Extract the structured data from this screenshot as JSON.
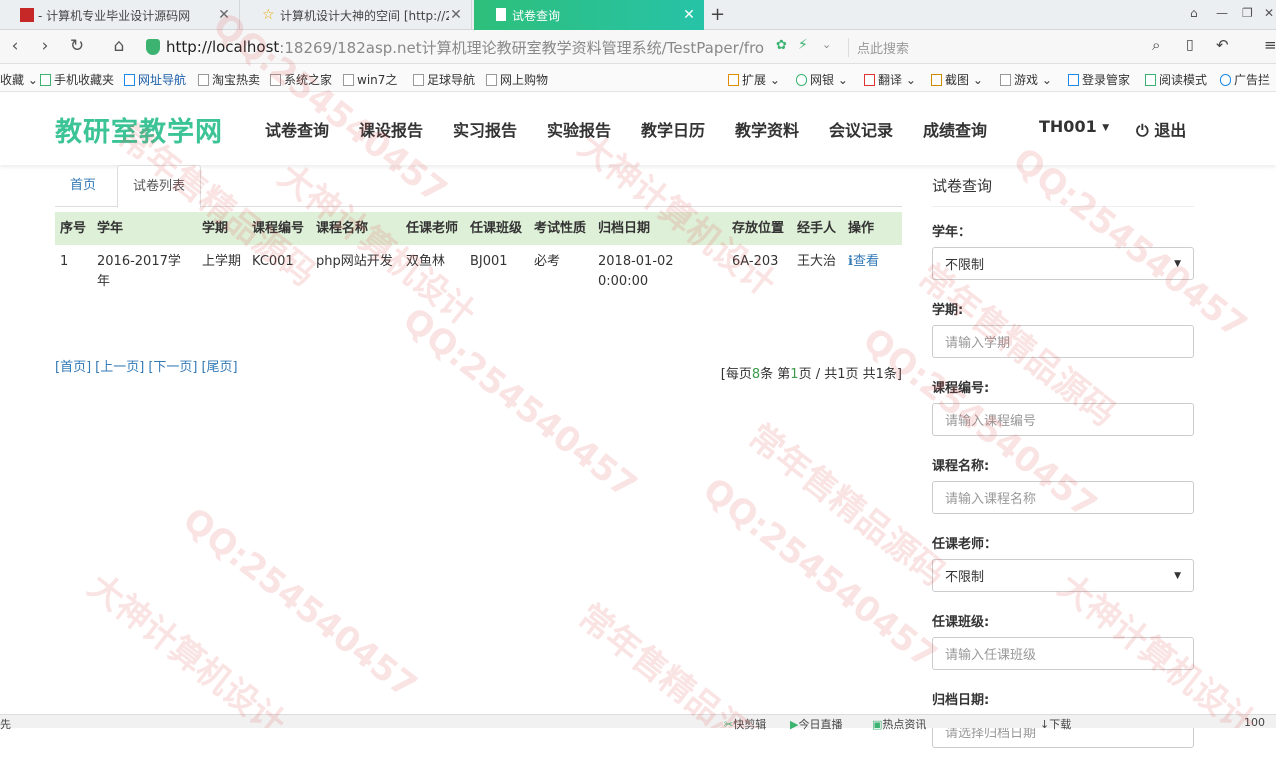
{
  "browser": {
    "tabs": [
      {
        "title": "- 计算机专业毕业设计源码网"
      },
      {
        "title": "计算机设计大神的空间 [http://2"
      },
      {
        "title": "试卷查询"
      }
    ],
    "url_host": "http://localhost",
    "url_rest": ":18269/182asp.net计算机理论教研室教学资料管理系统/TestPaper/fro",
    "search_placeholder": "点此搜索",
    "bookmarks": [
      "收藏",
      "手机收藏夹",
      "网址导航",
      "淘宝热卖",
      "系统之家",
      "win7之",
      "足球导航",
      "网上购物"
    ],
    "tools": [
      "扩展",
      "网银",
      "翻译",
      "截图",
      "游戏",
      "登录管家",
      "阅读模式",
      "广告拦"
    ],
    "status": [
      "快剪辑",
      "今日直播",
      "热点资讯",
      "下载",
      "100"
    ]
  },
  "site": {
    "brand": "教研室教学网",
    "menu": [
      "试卷查询",
      "课设报告",
      "实习报告",
      "实验报告",
      "教学日历",
      "教学资料",
      "会议记录",
      "成绩查询"
    ],
    "user": "TH001",
    "logout": "退出"
  },
  "content_tabs": {
    "home": "首页",
    "list": "试卷列表"
  },
  "table": {
    "headers": [
      "序号",
      "学年",
      "学期",
      "课程编号",
      "课程名称",
      "任课老师",
      "任课班级",
      "考试性质",
      "归档日期",
      "存放位置",
      "经手人",
      "操作"
    ],
    "rows": [
      [
        "1",
        "2016-2017学年",
        "上学期",
        "KC001",
        "php网站开发",
        "双鱼林",
        "BJ001",
        "必考",
        "2018-01-02 0:00:00",
        "6A-203",
        "王大治"
      ]
    ],
    "action_label": "查看"
  },
  "pager": {
    "first": "[首页]",
    "prev": "[上一页]",
    "next": "[下一页]",
    "last": "[尾页]",
    "info_a": "[每页",
    "per_page": "8",
    "info_b": "条 第",
    "page": "1",
    "info_c": "页 / 共",
    "pages": "1",
    "info_d": "页 共",
    "total": "1",
    "info_e": "条]"
  },
  "filter": {
    "title": "试卷查询",
    "fields": [
      {
        "label": "学年：",
        "type": "select",
        "value": "不限制"
      },
      {
        "label": "学期:",
        "type": "input",
        "placeholder": "请输入学期"
      },
      {
        "label": "课程编号:",
        "type": "input",
        "placeholder": "请输入课程编号"
      },
      {
        "label": "课程名称:",
        "type": "input",
        "placeholder": "请输入课程名称"
      },
      {
        "label": "任课老师：",
        "type": "select",
        "value": "不限制"
      },
      {
        "label": "任课班级:",
        "type": "input",
        "placeholder": "请输入任课班级"
      },
      {
        "label": "归档日期:",
        "type": "input",
        "placeholder": "请选择归档日期"
      }
    ]
  },
  "watermark": [
    "QQ:254540457",
    "大神计算机设计",
    "常年售精品源码"
  ],
  "colors": {
    "brand": "#3cc496",
    "header_row": "#dff0d8",
    "link": "#337ab7",
    "active_tab": "#2dbf7a"
  }
}
